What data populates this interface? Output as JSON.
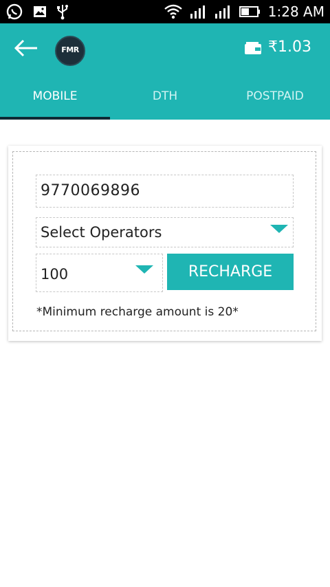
{
  "status_bar": {
    "time": "1:28 AM"
  },
  "app_bar": {
    "balance": "₹1.03",
    "logo_text": "FMR"
  },
  "tabs": [
    {
      "label": "MOBILE"
    },
    {
      "label": "DTH"
    },
    {
      "label": "POSTPAID"
    }
  ],
  "form": {
    "phone_value": "9770069896",
    "operator_value": "Select Operators",
    "amount_value": "100",
    "recharge_label": "RECHARGE",
    "note": "*Minimum recharge amount is 20*"
  },
  "colors": {
    "accent": "#1fb5b3",
    "tab_indicator": "#0e2a35"
  }
}
